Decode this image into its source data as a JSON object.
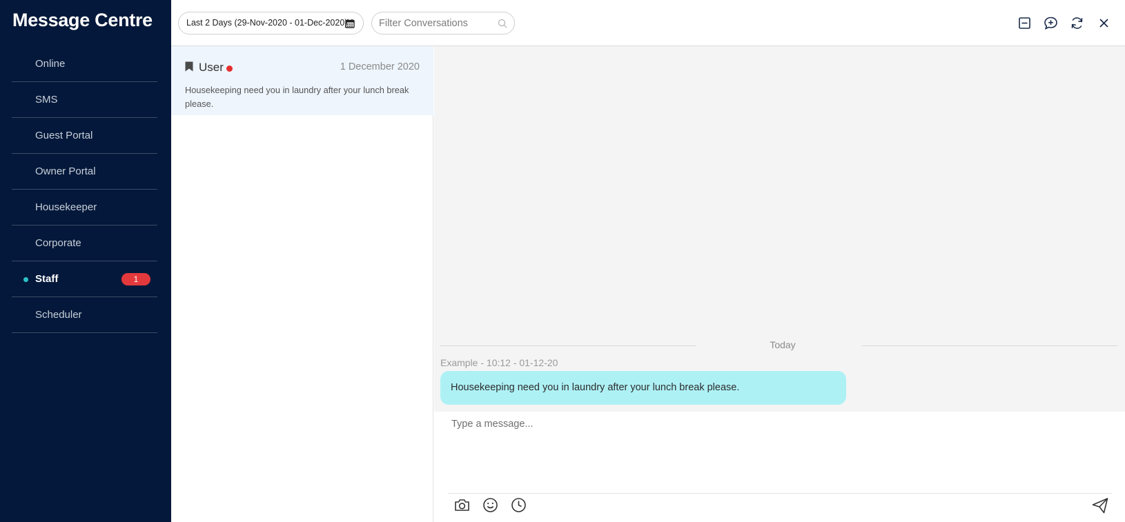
{
  "sidebar": {
    "title": "Message Centre",
    "items": [
      {
        "label": "Online"
      },
      {
        "label": "SMS"
      },
      {
        "label": "Guest Portal"
      },
      {
        "label": "Owner Portal"
      },
      {
        "label": "Housekeeper"
      },
      {
        "label": "Corporate"
      },
      {
        "label": "Staff",
        "badge": "1"
      },
      {
        "label": "Scheduler"
      }
    ],
    "active_item": "Staff",
    "colors": {
      "background": "#03183a",
      "active_dot": "#2bc3c8",
      "badge": "#e3393c"
    }
  },
  "topbar": {
    "date_filter": "Last 2 Days (29-Nov-2020 - 01-Dec-2020)",
    "filter_placeholder": "Filter Conversations",
    "icons": [
      "minimize-icon",
      "new-conversation-icon",
      "refresh-icon",
      "close-icon"
    ]
  },
  "conversations": [
    {
      "name": "User",
      "date": "1 December 2020",
      "preview": "Housekeeping need you in laundry after your lunch break please.",
      "unread": true
    }
  ],
  "chat": {
    "day_label": "Today",
    "messages": [
      {
        "meta": "Example - 10:12 - 01-12-20",
        "text": "Housekeeping need you in laundry after your lunch break please.",
        "color": "#aef1f5"
      }
    ]
  },
  "compose": {
    "placeholder": "Type a message...",
    "tools": [
      "camera-icon",
      "emoji-icon",
      "clock-icon",
      "send-icon"
    ]
  }
}
